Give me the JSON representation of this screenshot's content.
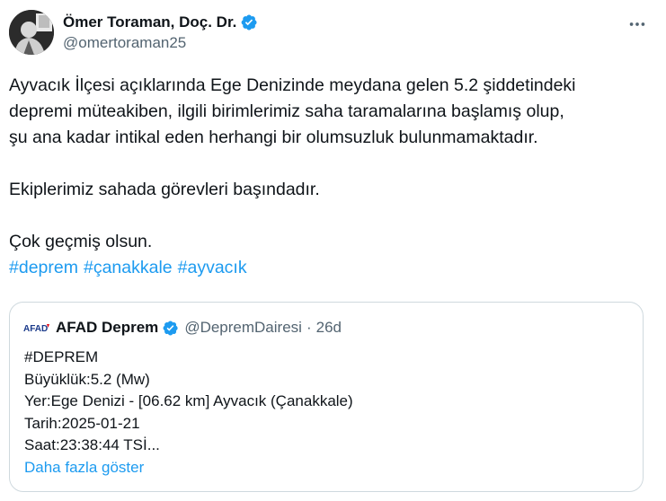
{
  "author": {
    "name": "Ömer Toraman, Doç. Dr.",
    "handle": "@omertoraman25",
    "verified_color": "#1d9bf0"
  },
  "more_icon": "more-horizontal-icon",
  "tweet": {
    "lines": [
      "Ayvacık İlçesi açıklarında Ege Denizinde meydana gelen 5.2 şiddetindeki",
      "depremi müteakiben, ilgili birimlerimiz saha taramalarına başlamış olup,",
      "şu ana kadar intikal eden herhangi bir olumsuzluk bulunmamaktadır."
    ],
    "paragraph2": "Ekiplerimiz sahada görevleri başındadır.",
    "paragraph3": "Çok geçmiş olsun.",
    "hashtags": [
      "#deprem",
      "#çanakkale",
      "#ayvacık"
    ]
  },
  "quote": {
    "logo_text": "AFAD",
    "name": "AFAD Deprem",
    "handle": "@DepremDairesi",
    "separator": "·",
    "time": "26d",
    "lines": [
      "#DEPREM",
      "Büyüklük:5.2 (Mw)",
      "Yer:Ege Denizi - [06.62 km] Ayvacık (Çanakkale)",
      "Tarih:2025-01-21",
      "Saat:23:38:44 TSİ..."
    ],
    "show_more": "Daha fazla göster"
  },
  "colors": {
    "link": "#1d9bf0",
    "text": "#0f1419",
    "secondary": "#536471",
    "afad_red": "#e30613",
    "afad_blue": "#1a3a8a"
  }
}
